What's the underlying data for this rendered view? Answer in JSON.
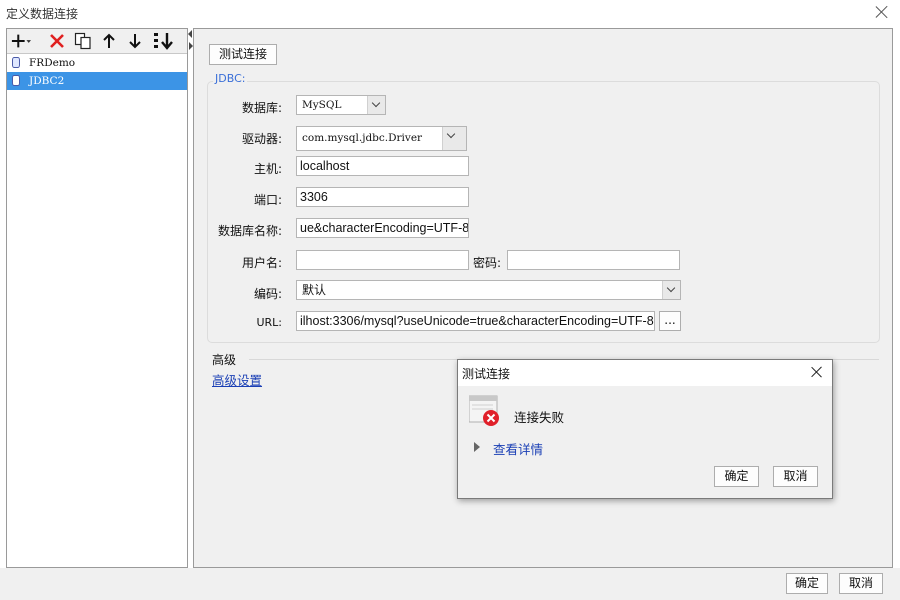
{
  "window": {
    "title": "定义数据连接"
  },
  "toolbar": {
    "icons": [
      "plus-icon",
      "delete-icon",
      "copy-icon",
      "up-arrow-icon",
      "down-arrow-icon",
      "sort-icon"
    ]
  },
  "connections": [
    {
      "label": "FRDemo",
      "selected": false
    },
    {
      "label": "JDBC2",
      "selected": true
    }
  ],
  "form": {
    "test_button": "测试连接",
    "group_label": "JDBC:",
    "database_label": "数据库:",
    "database_value": "MySQL",
    "driver_label": "驱动器:",
    "driver_value": "com.mysql.jdbc.Driver",
    "host_label": "主机:",
    "host_value": "localhost",
    "port_label": "端口:",
    "port_value": "3306",
    "dbname_label": "数据库名称:",
    "dbname_value": "ue&characterEncoding=UTF-8",
    "username_label": "用户名:",
    "username_value": "",
    "password_label": "密码:",
    "password_value": "",
    "encoding_label": "编码:",
    "encoding_value": "默认",
    "url_label": "URL:",
    "url_value": "ilhost:3306/mysql?useUnicode=true&characterEncoding=UTF-8",
    "url_more_button": "..."
  },
  "advanced": {
    "title": "高级",
    "link": "高级设置"
  },
  "footer": {
    "ok": "确定",
    "cancel": "取消"
  },
  "dialog": {
    "title": "测试连接",
    "message": "连接失败",
    "detail_link": "查看详情",
    "ok": "确定",
    "cancel": "取消",
    "icon_color": "#e0202a"
  }
}
